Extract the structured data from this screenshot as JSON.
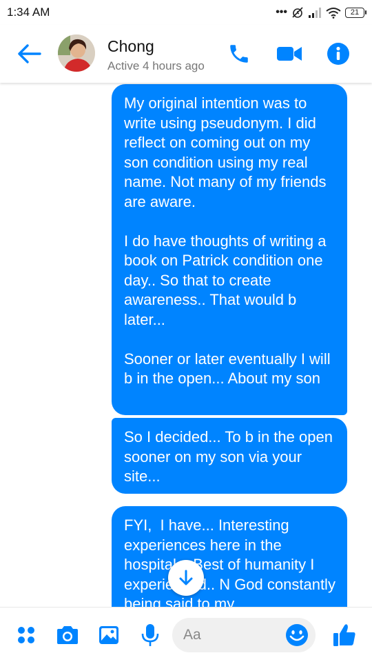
{
  "status_bar": {
    "time": "1:34 AM",
    "battery": "21"
  },
  "header": {
    "contact_name": "Chong",
    "contact_status": "Active 4 hours ago"
  },
  "messages": [
    {
      "text": "My original intention was to write using pseudonym. I did reflect on coming out on my son condition using my real name. Not many of my friends are aware.\n\nI do have thoughts of writing a book on Patrick condition one day.. So that to create awareness.. That would b later...\n\nSooner or later eventually I will b in the open... About my son"
    },
    {
      "text": "So I decided... To b in the open sooner on my son via your site..."
    },
    {
      "text": "FYI,  I have... Interesting experiences here in the hospital... Best of humanity I experienced.. N God constantly being said to my"
    }
  ],
  "composer": {
    "placeholder": "Aa"
  },
  "colors": {
    "accent": "#0084ff",
    "bubble_text": "#ffffff"
  },
  "icons": [
    "back-arrow-icon",
    "phone-icon",
    "video-camera-icon",
    "info-icon",
    "scroll-down-arrow-icon",
    "apps-grid-icon",
    "camera-icon",
    "gallery-icon",
    "microphone-icon",
    "emoji-icon",
    "thumbs-up-icon"
  ]
}
